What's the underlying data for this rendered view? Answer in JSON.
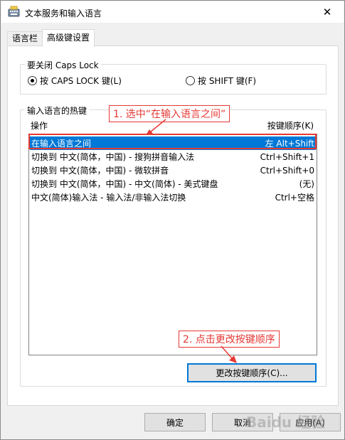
{
  "window": {
    "title": "文本服务和输入语言",
    "close_glyph": "✕"
  },
  "tabs": [
    {
      "label": "语言栏",
      "active": false
    },
    {
      "label": "高级键设置",
      "active": true
    }
  ],
  "caps_group": {
    "legend": "要关闭 Caps Lock",
    "option_caps": "按 CAPS LOCK 键(L)",
    "option_shift": "按 SHIFT 键(F)",
    "selected": "caps"
  },
  "hotkeys_group": {
    "legend": "输入语言的热键",
    "col_action": "操作",
    "col_sequence": "按键顺序(K)",
    "rows": [
      {
        "action": "在输入语言之间",
        "keys": "左 Alt+Shift",
        "selected": true
      },
      {
        "action": "切换到 中文(简体，中国) - 搜狗拼音输入法",
        "keys": "Ctrl+Shift+1",
        "selected": false
      },
      {
        "action": "切换到 中文(简体，中国) - 微软拼音",
        "keys": "Ctrl+Shift+0",
        "selected": false
      },
      {
        "action": "切换到 中文(简体，中国) - 中文(简体) - 美式键盘",
        "keys": "(无)",
        "selected": false
      },
      {
        "action": "中文(简体)输入法 - 输入法/非输入法切换",
        "keys": "Ctrl+空格",
        "selected": false
      }
    ],
    "change_button": "更改按键顺序(C)..."
  },
  "annotations": {
    "step1": "1. 选中“在输入语言之间”",
    "step2": "2. 点击更改按键顺序",
    "color": "#e53935"
  },
  "footer": {
    "ok": "确定",
    "cancel": "取消",
    "apply": "应用(A)"
  },
  "watermark": "Baidu 经验",
  "colors": {
    "selection": "#0078d7",
    "annotation": "#e53935"
  }
}
